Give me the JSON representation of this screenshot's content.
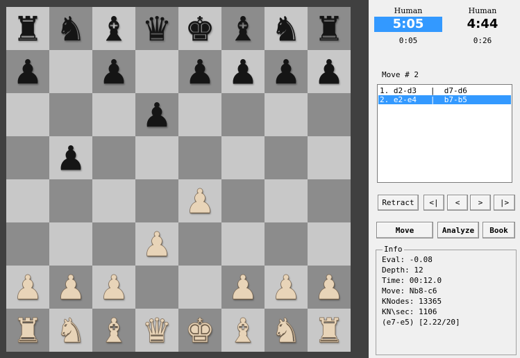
{
  "board": {
    "rows": [
      [
        {
          "p": "♜",
          "c": "black",
          "n": "black-rook-icon"
        },
        {
          "p": "♞",
          "c": "black",
          "n": "black-knight-icon"
        },
        {
          "p": "♝",
          "c": "black",
          "n": "black-bishop-icon"
        },
        {
          "p": "♛",
          "c": "black",
          "n": "black-queen-icon"
        },
        {
          "p": "♚",
          "c": "black",
          "n": "black-king-icon"
        },
        {
          "p": "♝",
          "c": "black",
          "n": "black-bishop-icon"
        },
        {
          "p": "♞",
          "c": "black",
          "n": "black-knight-icon"
        },
        {
          "p": "♜",
          "c": "black",
          "n": "black-rook-icon"
        }
      ],
      [
        {
          "p": "♟",
          "c": "black",
          "n": "black-pawn-icon"
        },
        null,
        {
          "p": "♟",
          "c": "black",
          "n": "black-pawn-icon"
        },
        null,
        {
          "p": "♟",
          "c": "black",
          "n": "black-pawn-icon"
        },
        {
          "p": "♟",
          "c": "black",
          "n": "black-pawn-icon"
        },
        {
          "p": "♟",
          "c": "black",
          "n": "black-pawn-icon"
        },
        {
          "p": "♟",
          "c": "black",
          "n": "black-pawn-icon"
        }
      ],
      [
        null,
        null,
        null,
        {
          "p": "♟",
          "c": "black",
          "n": "black-pawn-icon"
        },
        null,
        null,
        null,
        null
      ],
      [
        null,
        {
          "p": "♟",
          "c": "black",
          "n": "black-pawn-icon"
        },
        null,
        null,
        null,
        null,
        null,
        null
      ],
      [
        null,
        null,
        null,
        null,
        {
          "p": "♟",
          "c": "white",
          "n": "white-pawn-icon"
        },
        null,
        null,
        null
      ],
      [
        null,
        null,
        null,
        {
          "p": "♟",
          "c": "white",
          "n": "white-pawn-icon"
        },
        null,
        null,
        null,
        null
      ],
      [
        {
          "p": "♟",
          "c": "white",
          "n": "white-pawn-icon"
        },
        {
          "p": "♟",
          "c": "white",
          "n": "white-pawn-icon"
        },
        {
          "p": "♟",
          "c": "white",
          "n": "white-pawn-icon"
        },
        null,
        null,
        {
          "p": "♟",
          "c": "white",
          "n": "white-pawn-icon"
        },
        {
          "p": "♟",
          "c": "white",
          "n": "white-pawn-icon"
        },
        {
          "p": "♟",
          "c": "white",
          "n": "white-pawn-icon"
        }
      ],
      [
        {
          "p": "♜",
          "c": "white",
          "n": "white-rook-icon"
        },
        {
          "p": "♞",
          "c": "white",
          "n": "white-knight-icon"
        },
        {
          "p": "♝",
          "c": "white",
          "n": "white-bishop-icon"
        },
        {
          "p": "♛",
          "c": "white",
          "n": "white-queen-icon"
        },
        {
          "p": "♚",
          "c": "white",
          "n": "white-king-icon"
        },
        {
          "p": "♝",
          "c": "white",
          "n": "white-bishop-icon"
        },
        {
          "p": "♞",
          "c": "white",
          "n": "white-knight-icon"
        },
        {
          "p": "♜",
          "c": "white",
          "n": "white-rook-icon"
        }
      ]
    ],
    "light_color": "#c8c8c8",
    "dark_color": "#8c8c8c"
  },
  "players": {
    "left": {
      "label": "Human",
      "clock": "5:05",
      "move_time": "0:05"
    },
    "right": {
      "label": "Human",
      "clock": "4:44",
      "move_time": "0:26"
    }
  },
  "move_number": "Move # 2",
  "moves": [
    {
      "text": "1. d2-d3   |  d7-d6",
      "selected": false
    },
    {
      "text": "2. e2-e4   |  b7-b5",
      "selected": true
    }
  ],
  "buttons": {
    "retract": "Retract",
    "first": "<|",
    "prev": "<",
    "next": ">",
    "last": "|>",
    "move": "Move",
    "analyze": "Analyze",
    "book": "Book"
  },
  "info": {
    "legend": "Info",
    "lines": [
      "Eval: -0.08",
      "Depth: 12",
      "Time: 00:12.0",
      "Move: Nb8-c6",
      "KNodes: 13365",
      "KN\\sec: 1106",
      "(e7-e5) [2.22/20]"
    ]
  },
  "colors": {
    "accent": "#3399ff",
    "frame": "#404040"
  }
}
